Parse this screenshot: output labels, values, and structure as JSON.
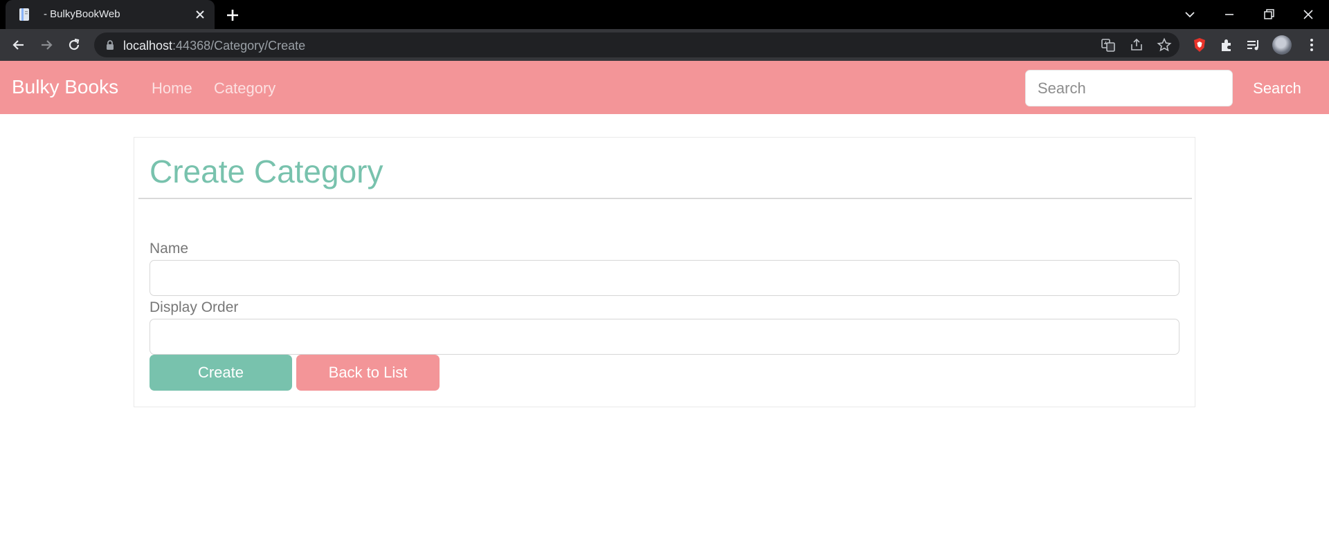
{
  "browser": {
    "tab_title": "- BulkyBookWeb",
    "url_host": "localhost",
    "url_path": ":44368/Category/Create"
  },
  "navbar": {
    "brand": "Bulky Books",
    "links": [
      "Home",
      "Category"
    ],
    "search_placeholder": "Search",
    "search_button": "Search"
  },
  "form": {
    "title": "Create Category",
    "fields": [
      {
        "label": "Name",
        "value": ""
      },
      {
        "label": "Display Order",
        "value": ""
      }
    ],
    "create_button": "Create",
    "back_button": "Back to List"
  },
  "colors": {
    "primary": "#78c2ad",
    "secondary": "#f39598",
    "browser_bar": "#35363a"
  }
}
